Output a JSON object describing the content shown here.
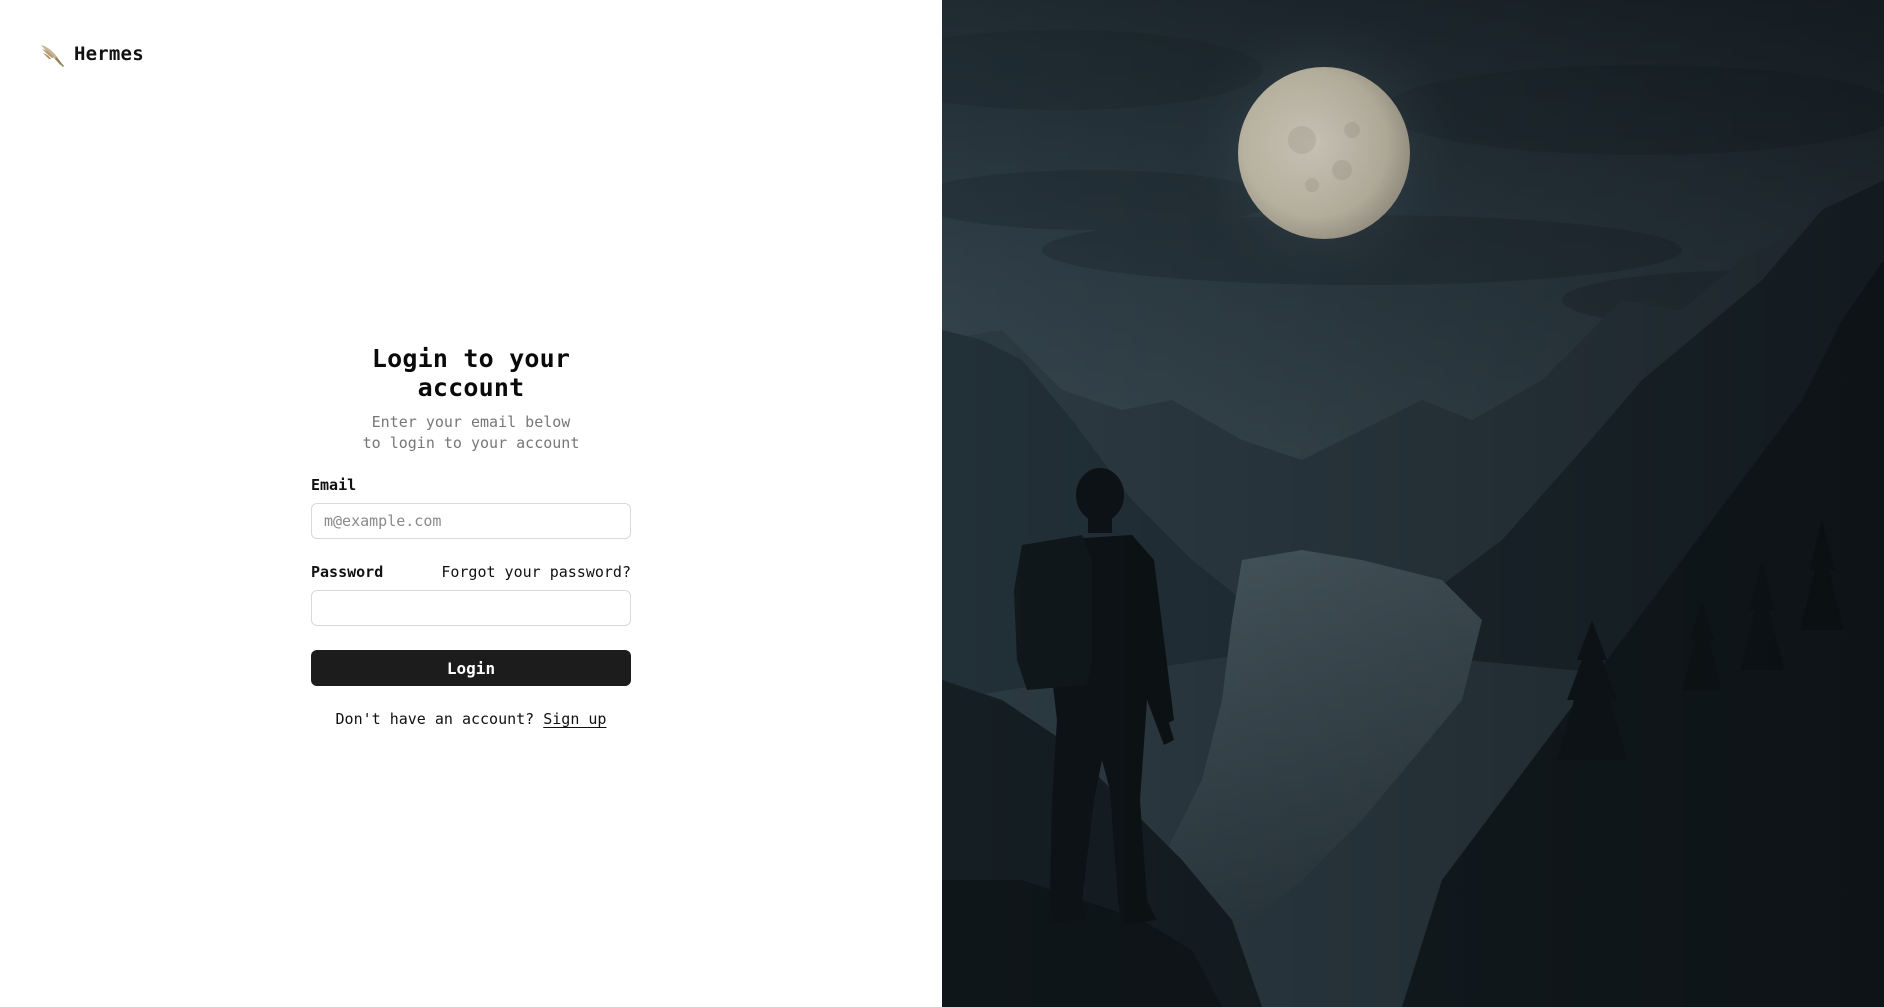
{
  "brand": {
    "name": "Hermes",
    "logo_icon": "winged-feather-icon"
  },
  "login": {
    "title": "Login to your account",
    "subtitle_line1": "Enter your email below",
    "subtitle_line2": "to login to your account",
    "email_label": "Email",
    "email_placeholder": "m@example.com",
    "email_value": "",
    "password_label": "Password",
    "forgot_link": "Forgot your password?",
    "password_value": "",
    "submit_label": "Login",
    "signup_prompt": "Don't have an account?",
    "signup_link": "Sign up"
  },
  "hero": {
    "scene": "night-landscape-image",
    "colors": {
      "sky": "#2b3a44",
      "moon": "#d8d2c0",
      "mountains": "#1e2a31",
      "water": "#34434b",
      "silhouette": "#0f1518"
    }
  },
  "colors": {
    "primary_button": "#1c1c1c",
    "muted_text": "#777777",
    "input_border": "#d9d9d9"
  }
}
